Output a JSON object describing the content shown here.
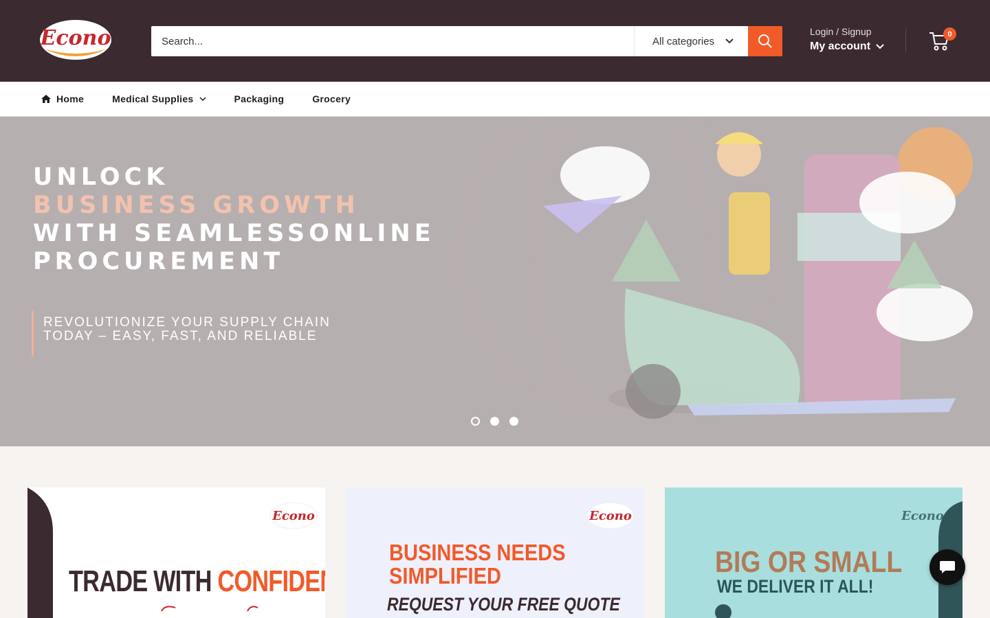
{
  "header": {
    "logo_text": "Econo",
    "search_placeholder": "Search...",
    "category_selected": "All categories",
    "login_label": "Login / Signup",
    "account_label": "My account",
    "cart_count": "0"
  },
  "nav": {
    "items": [
      {
        "label": "Home"
      },
      {
        "label": "Medical Supplies"
      },
      {
        "label": "Packaging"
      },
      {
        "label": "Grocery"
      }
    ]
  },
  "hero": {
    "line1": "UNLOCK",
    "line2": "BUSINESS GROWTH",
    "line3": "WITH SEAMLESSONLINE",
    "line4": "PROCUREMENT",
    "sub1": "REVOLUTIONIZE YOUR SUPPLY CHAIN",
    "sub2": "TODAY – EASY, FAST, AND RELIABLE",
    "slides": 3,
    "active_slide": 1
  },
  "cards": [
    {
      "title_dark": "TRADE WITH ",
      "title_orange": "CONFIDENCE"
    },
    {
      "title_line1": "BUSINESS NEEDS",
      "title_line2": "SIMPLIFIED",
      "subtitle": "REQUEST YOUR FREE QUOTE"
    },
    {
      "title": "BIG OR SMALL",
      "subtitle": "WE DELIVER IT ALL!"
    }
  ],
  "colors": {
    "header_bg": "#3b2a30",
    "accent": "#f15a29",
    "hero_bg": "#b6afb0"
  }
}
